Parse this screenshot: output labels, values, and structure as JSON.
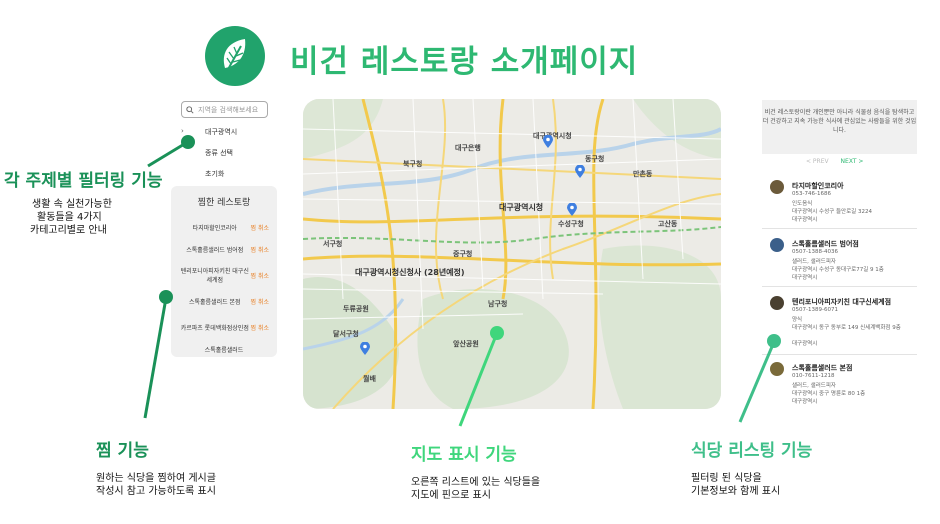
{
  "header": {
    "title": "비건 레스토랑 소개페이지",
    "logo_icon": "leaf-icon",
    "brand_color": "#21a36c"
  },
  "sidebar": {
    "search_placeholder": "지역을 검색해보세요",
    "menu": [
      "대구광역시",
      "종류 선택",
      "초기화"
    ]
  },
  "favorites": {
    "title": "찜한 레스토랑",
    "remove_label": "찜 취소",
    "items": [
      "타지마할인코리아",
      "스톡홀름샐러드 범어점",
      "텐리포니아피자키친 대구신세계점",
      "스톡홀름샐러드 본점",
      "카르파츠 롯데백화점상인점",
      "스톡홀름샐러드"
    ]
  },
  "map": {
    "labels": [
      "대구광역시청",
      "대구광역시청신청사 (28년예정)",
      "대구광역시청",
      "동구청",
      "수성구청",
      "대구은행",
      "두류공원",
      "앞산공원",
      "만촌동",
      "고산동",
      "중구청",
      "북구청",
      "서구청",
      "남구청",
      "달서구청",
      "월배"
    ]
  },
  "info": {
    "text": "비건 레스토랑이란 개인뿐만 아니라 식물성 음식을 탐색하고 더 건강하고 지속 가능한 식사에 관심있는 사람들을 위한 것입니다.",
    "prev": "< PREV",
    "next": "NEXT >"
  },
  "restaurants": [
    {
      "name": "타지마할인코리아",
      "lines": [
        "053-746-1686",
        "인도음식",
        "대구광역시 수성구 들안로길 3224",
        "대구광역시"
      ]
    },
    {
      "name": "스톡홀름샐러드 범어점",
      "lines": [
        "0507-1388-4036",
        "샐러드, 샐러드피자",
        "대구광역시 수성구 동대구로77길 9 1층",
        "대구광역시"
      ]
    },
    {
      "name": "텐리포니아피자키친 대구신세계점",
      "lines": [
        "0507-1389-6071",
        "양식",
        "대구광역시 동구 동부로 149 신세계백화점 9층",
        "대구광역시"
      ]
    },
    {
      "name": "스톡홀름샐러드 본점",
      "lines": [
        "010-7611-1218",
        "샐러드, 샐러드피자",
        "대구광역시 중구 명륜로 80 1층",
        "대구광역시"
      ]
    }
  ],
  "annotations": {
    "filter": {
      "title": "각 주제별 필터링 기능",
      "desc": [
        "생활 속 실천가능한",
        "활동들을 4가지",
        "카테고리별로 안내"
      ],
      "color": "#1a9158"
    },
    "fav": {
      "title": "찜 기능",
      "desc": [
        "원하는 식당을 찜하여 게시글",
        "작성시 참고 가능하도록 표시"
      ],
      "color": "#1a9158"
    },
    "map": {
      "title": "지도 표시 기능",
      "desc": [
        "오른쪽 리스트에 있는 식당들을",
        "지도에 핀으로 표시"
      ],
      "color": "#3fd67c"
    },
    "list": {
      "title": "식당 리스팅 기능",
      "desc": [
        "필터링 된 식당을",
        "기본정보와 함께 표시"
      ],
      "color": "#3fbf8a"
    }
  }
}
